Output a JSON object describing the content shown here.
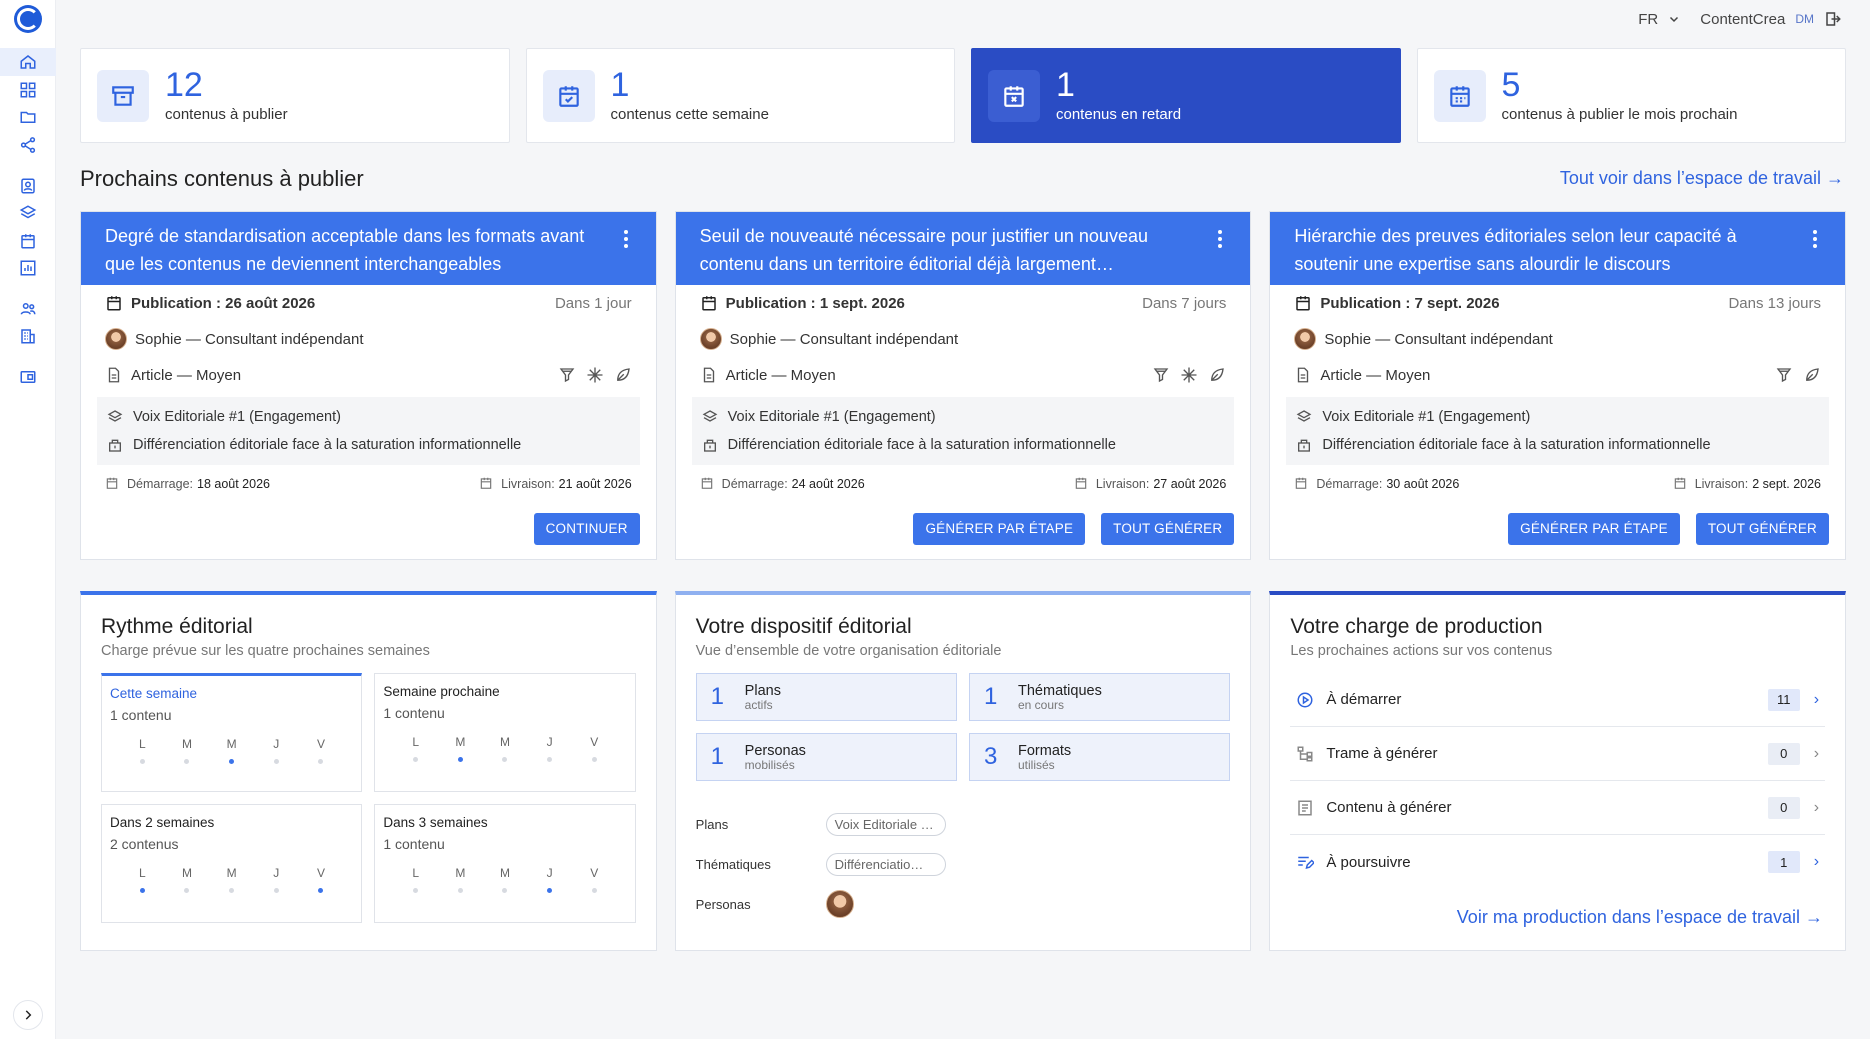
{
  "topbar": {
    "lang": "FR",
    "workspace": "ContentCrea",
    "user_initials": "DM"
  },
  "stats": [
    {
      "number": "12",
      "label": "contenus à publier",
      "icon": "archive-icon"
    },
    {
      "number": "1",
      "label": "contenus cette semaine",
      "icon": "calendar-check-icon"
    },
    {
      "number": "1",
      "label": "contenus en retard",
      "icon": "calendar-x-icon"
    },
    {
      "number": "5",
      "label": "contenus à publier le mois prochain",
      "icon": "calendar-grid-icon"
    }
  ],
  "section": {
    "title": "Prochains contenus à publier",
    "see_all": "Tout voir dans l’espace de travail"
  },
  "cards": [
    {
      "title": "Degré de standardisation acceptable dans les formats avant que les contenus ne deviennent interchangeables",
      "pub_label": "Publication : 26 août 2026",
      "when": "Dans 1 jour",
      "author": "Sophie — Consultant indépendant",
      "format": "Article — Moyen",
      "voice": "Voix Editoriale #1 (Engagement)",
      "theme": "Différenciation éditoriale face à la saturation informationnelle",
      "start_label": "Démarrage:",
      "start": "18 août 2026",
      "delivery_label": "Livraison:",
      "delivery": "21 août 2026",
      "buttons": [
        "CONTINUER"
      ]
    },
    {
      "title": "Seuil de nouveauté nécessaire pour justifier un nouveau contenu dans un territoire éditorial déjà largement…",
      "pub_label": "Publication : 1 sept. 2026",
      "when": "Dans 7 jours",
      "author": "Sophie — Consultant indépendant",
      "format": "Article — Moyen",
      "voice": "Voix Editoriale #1 (Engagement)",
      "theme": "Différenciation éditoriale face à la saturation informationnelle",
      "start_label": "Démarrage:",
      "start": "24 août 2026",
      "delivery_label": "Livraison:",
      "delivery": "27 août 2026",
      "buttons": [
        "GÉNÉRER PAR ÉTAPE",
        "TOUT GÉNÉRER"
      ]
    },
    {
      "title": "Hiérarchie des preuves éditoriales selon leur capacité à soutenir une expertise sans alourdir le discours",
      "pub_label": "Publication : 7 sept. 2026",
      "when": "Dans 13 jours",
      "author": "Sophie — Consultant indépendant",
      "format": "Article — Moyen",
      "voice": "Voix Editoriale #1 (Engagement)",
      "theme": "Différenciation éditoriale face à la saturation informationnelle",
      "start_label": "Démarrage:",
      "start": "30 août 2026",
      "delivery_label": "Livraison:",
      "delivery": "2 sept. 2026",
      "buttons": [
        "GÉNÉRER PAR ÉTAPE",
        "TOUT GÉNÉRER"
      ]
    }
  ],
  "rhythm": {
    "title": "Rythme éditorial",
    "subtitle": "Charge prévue sur les quatre prochaines semaines",
    "days": [
      "L",
      "M",
      "M",
      "J",
      "V"
    ],
    "weeks": [
      {
        "title": "Cette semaine",
        "count": "1 contenu",
        "active": [
          2
        ]
      },
      {
        "title": "Semaine prochaine",
        "count": "1 contenu",
        "active": [
          1
        ]
      },
      {
        "title": "Dans 2 semaines",
        "count": "2 contenus",
        "active": [
          0,
          4
        ]
      },
      {
        "title": "Dans 3 semaines",
        "count": "1 contenu",
        "active": [
          3
        ]
      }
    ]
  },
  "dispositif": {
    "title": "Votre dispositif éditorial",
    "subtitle": "Vue d’ensemble de votre organisation éditoriale",
    "tiles": [
      {
        "n": "1",
        "label": "Plans",
        "sub": "actifs"
      },
      {
        "n": "1",
        "label": "Thématiques",
        "sub": "en cours"
      },
      {
        "n": "1",
        "label": "Personas",
        "sub": "mobilisés"
      },
      {
        "n": "3",
        "label": "Formats",
        "sub": "utilisés"
      }
    ],
    "plans_label": "Plans",
    "plans_chip": "Voix Editoriale …",
    "themes_label": "Thématiques",
    "themes_chip": "Différenciatio…",
    "personas_label": "Personas"
  },
  "production": {
    "title": "Votre charge de production",
    "subtitle": "Les prochaines actions sur vos contenus",
    "rows": [
      {
        "label": "À démarrer",
        "count": "11"
      },
      {
        "label": "Trame à générer",
        "count": "0"
      },
      {
        "label": "Contenu à générer",
        "count": "0"
      },
      {
        "label": "À poursuivre",
        "count": "1"
      }
    ],
    "link": "Voir ma production dans l’espace de travail"
  }
}
